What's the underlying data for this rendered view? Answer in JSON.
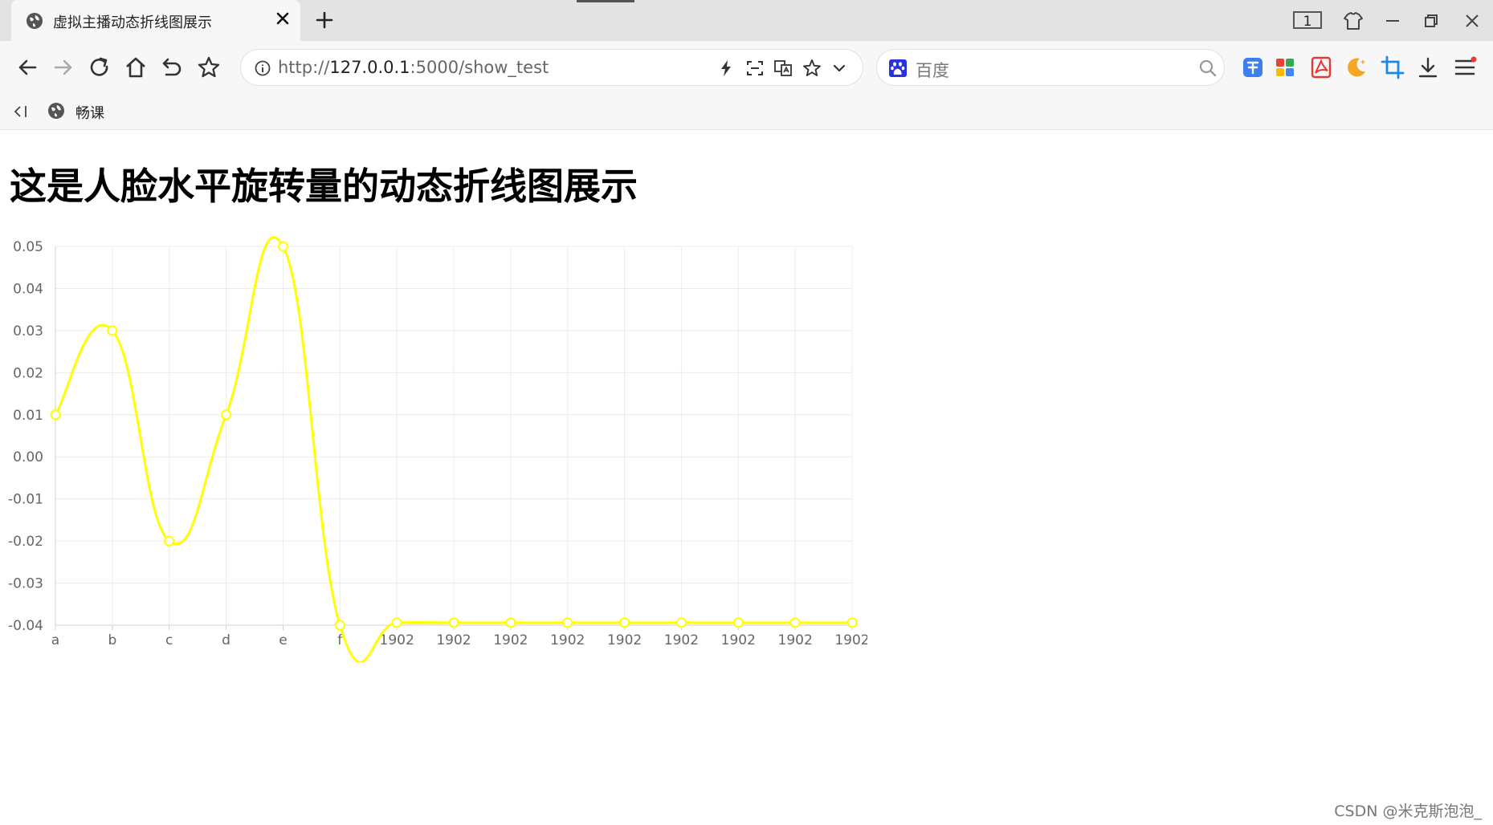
{
  "browser": {
    "tab": {
      "title": "虚拟主播动态折线图展示"
    },
    "tab_count": "1",
    "address": {
      "scheme": "http://",
      "host": "127.0.0.1",
      "rest": ":5000/show_test"
    },
    "search_placeholder": "百度",
    "bookmarks": [
      {
        "label": "畅课"
      }
    ]
  },
  "page": {
    "heading": "这是人脸水平旋转量的动态折线图展示"
  },
  "chart_data": {
    "type": "line",
    "smooth": true,
    "categories": [
      "a",
      "b",
      "c",
      "d",
      "e",
      "f",
      "1902",
      "1902",
      "1902",
      "1902",
      "1902",
      "1902",
      "1902",
      "1902",
      "1902"
    ],
    "series": [
      {
        "values": [
          0.01,
          0.03,
          -0.02,
          0.01,
          0.05,
          -0.04,
          -0.0394,
          -0.0394,
          -0.0394,
          -0.0394,
          -0.0394,
          -0.0394,
          -0.0394,
          -0.0394,
          -0.0394
        ]
      }
    ],
    "ylim": [
      -0.04,
      0.05
    ],
    "yticks": [
      "0.05",
      "0.04",
      "0.03",
      "0.02",
      "0.01",
      "0.00",
      "-0.01",
      "-0.02",
      "-0.03",
      "-0.04"
    ],
    "line_color": "#ffff00",
    "grid": true
  },
  "watermark": "CSDN @米克斯泡泡_"
}
